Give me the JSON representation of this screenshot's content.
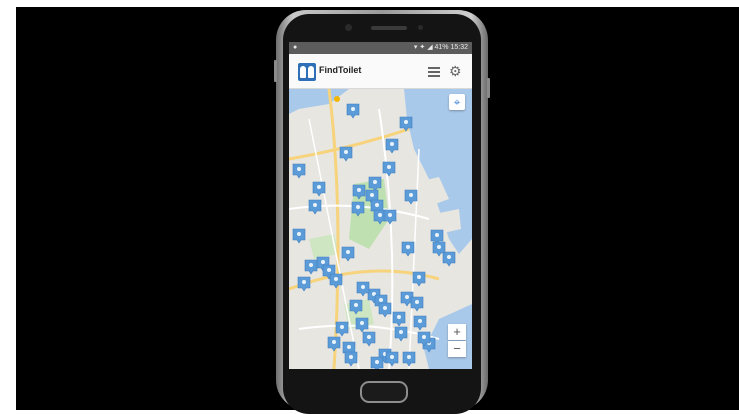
{
  "status_bar": {
    "left_icon": "notification-icon",
    "right_text": "▾ ✦ ◢ 41% 15:32"
  },
  "app": {
    "title": "FindToilet",
    "logo_icon": "toilet-figures-icon",
    "list_icon": "list-icon",
    "settings_icon": "gear-icon"
  },
  "map": {
    "marker_icon": "toilet-marker-icon",
    "marker_count": 50,
    "locate_icon": "my-location-icon",
    "zoom_in": "+",
    "zoom_out": "−"
  },
  "colors": {
    "appbar": "#fafafa",
    "marker": "#5b9bd8",
    "water": "#a9c9ea",
    "land": "#e8e6e1",
    "park": "#bfe0b0",
    "road": "#f7d37c"
  }
}
